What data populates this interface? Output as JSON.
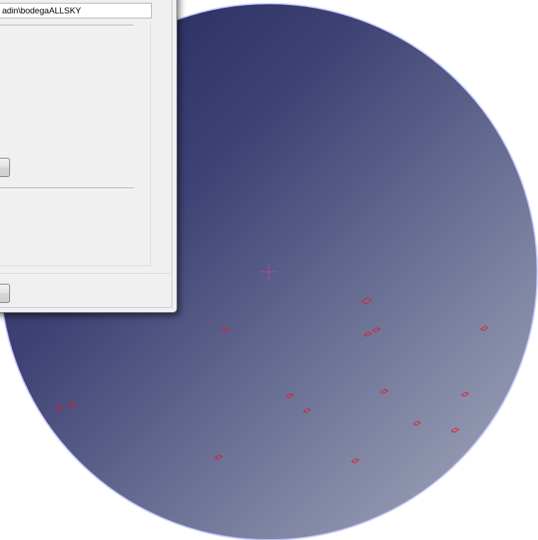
{
  "dialog": {
    "path_value": "adin\\bodegaALLSKY",
    "browse_label": "",
    "ok_label": ""
  },
  "sky_view": {
    "gradient_start": "#252a62",
    "gradient_end": "#9ea3b6",
    "border_color": "#c8ccff",
    "marker_color": "#e8132b",
    "center_marker_color": "#c43cc4",
    "center_marker_icon": "crosshair-icon",
    "star_marker_icon": "diamond-marker-icon"
  }
}
